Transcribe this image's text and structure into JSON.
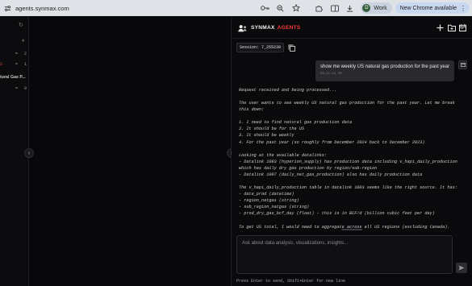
{
  "browser": {
    "url": "agents.synmax.com",
    "profile_initial": "D",
    "profile_name": "Work",
    "update_label": "New Chrome available"
  },
  "left_panel": {
    "rows": [
      {
        "key": "a",
        "value": "4"
      },
      {
        "key": "b",
        "value": "2"
      },
      {
        "key": "c",
        "value": "1"
      },
      {
        "key": "d",
        "value": "9"
      }
    ],
    "truncated_label": "tural Gas P..."
  },
  "agent": {
    "brand_part1": "SYNMAX",
    "brand_part2": "AGENTS",
    "accent_color": "#ff3b3b",
    "session_label": "Session: 7_255239",
    "user_message": "show me weekly US natural gas production for the past year",
    "user_time": "03:21:16 PM",
    "reply_lines": [
      "Request received and being processed...",
      "",
      "The user wants to see weekly US natural gas production for the past year. Let me break",
      "this down:",
      "",
      "1. I need to find natural gas production data",
      "2. It should be for the US",
      "3. It should be weekly",
      "4. For the past year (so roughly from December 2024 back to December 2023)",
      "",
      "Looking at the available datalinks:",
      "- Datalink 1003 (hyperion_supply) has production data including v_hapi_daily_production",
      "which has daily dry gas production by region/sub-region",
      "- Datalink 1007 (daily_net_gas_production) also has daily production data",
      "",
      "The v_hapi_daily_production table in datalink 1003 seems like the right source. It has:",
      "- date_prod (datetime)",
      "- region_natgas (string)",
      "- sub_region_natgas (string)",
      "- prod_dry_gas_bcf_day (float) - this is in BCF/d (billion cubic feet per day)",
      "",
      "To get US total, I would need to aggregate across all US regions (excluding Canada)."
    ],
    "composer_placeholder": "Ask about data analysis, visualizations, insights...",
    "hint": "Press Enter to send, Shift+Enter for new line"
  },
  "icons": {
    "site": "site-settings-icon",
    "password": "password-key-icon",
    "zoom": "zoom-icon",
    "bookmark": "star-icon",
    "extensions": "puzzle-icon",
    "reader": "reading-mode-icon",
    "download": "download-icon",
    "menu": "more-vertical-icon",
    "new_chat": "plus-icon",
    "folder": "folder-icon",
    "calendar": "calendar-icon",
    "copy": "copy-icon",
    "send": "send-icon"
  }
}
